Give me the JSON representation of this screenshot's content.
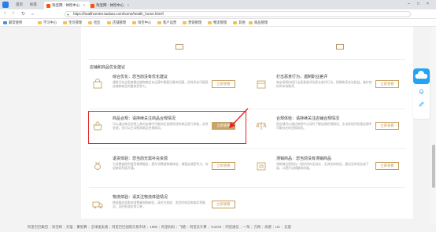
{
  "browser": {
    "home_label": "首页",
    "tabs_label": "标签",
    "tabs": [
      {
        "label": "淘宝网 - 体检中心",
        "active": true
      },
      {
        "label": "淘宝网 - 体检中心",
        "active": false
      }
    ],
    "url": "https://healthcenter.taobao.com/home/health_home.htm#/",
    "bookmarks": [
      "最常使用",
      "学习中心",
      "宝贝管理",
      "社区",
      "店铺管理",
      "淘宝中心",
      "客户运营",
      "营销管理",
      "物流管理",
      "其他",
      "商品管理"
    ]
  },
  "section": {
    "title": "店铺和商品优化建议"
  },
  "cards": [
    {
      "icon": "bag-icon",
      "title": "综合优化：您当前没有优化建议",
      "desc": "通常可在这里查看店铺和商品在运营中需要注意的问题，及时优化可提高店铺和商品的整体竞争力。",
      "button": "立即查看",
      "col": 0,
      "row": 0
    },
    {
      "icon": "calendar-icon",
      "title": "打击恶意行为，遏制职业差评",
      "desc": "淘宝网将持续打击恶意差评及职业差评行为，保障卖家合法权益，维护良好的市场秩序。",
      "button": "立即查看",
      "col": 1,
      "row": 0
    },
    {
      "icon": "handbag-icon",
      "title": "商品合规：请持续关注商品合规情况",
      "desc": "可以通过商品合规工具对店铺中可能存在违规风险的商品进行排查，及时处理，也可以主动检测商品合规情况。",
      "button": "立即查看",
      "col": 0,
      "row": 1
    },
    {
      "icon": "scale-icon",
      "title": "合规体检：请持续关注店铺合规情况",
      "desc": "您店铺可以通过体检中心及时了解店铺合规情况，主动发现并处理店铺中可能存在的违规风险。",
      "button": "立即查看",
      "col": 1,
      "row": 1
    },
    {
      "icon": "medal-icon",
      "title": "退货体验：您当前无需补充资源",
      "desc": "为消费者提供退货保障服务，提升消费者购物体验，增强店铺竞争力，欢迎商家积极开通。",
      "button": "立即查看",
      "col": 0,
      "row": 2
    },
    {
      "icon": "box-icon",
      "title": "滞销商品：您当前没有滞销商品",
      "desc": "滞销商品是指在一段时间内无成交、无浏览的商品，建议及时优化或下架，以提升店铺整体质量。",
      "button": "立即查看",
      "col": 1,
      "row": 2
    },
    {
      "icon": "truck-icon",
      "title": "物流体验：请关注物流体验情况",
      "desc": "物流服务会影响消费者购物体验，请关注揽收、发货时效及物流异常情况，及时处理异常订单。",
      "button": "立即查看",
      "col": 0,
      "row": 3
    }
  ],
  "footer": {
    "links": [
      "阿里巴巴集团",
      "淘宝网",
      "天猫",
      "聚划算",
      "全球速卖通",
      "阿里巴巴国际交易市场",
      "1688",
      "阿里妈妈",
      "飞猪",
      "阿里云计算",
      "YunOS",
      "阿里通信",
      "一淘",
      "万网",
      "高德",
      "UC",
      "友盟"
    ]
  },
  "colors": {
    "accent": "#c9a468",
    "highlight_box": "#e3262a",
    "floating_widget": "#22a4f3"
  }
}
